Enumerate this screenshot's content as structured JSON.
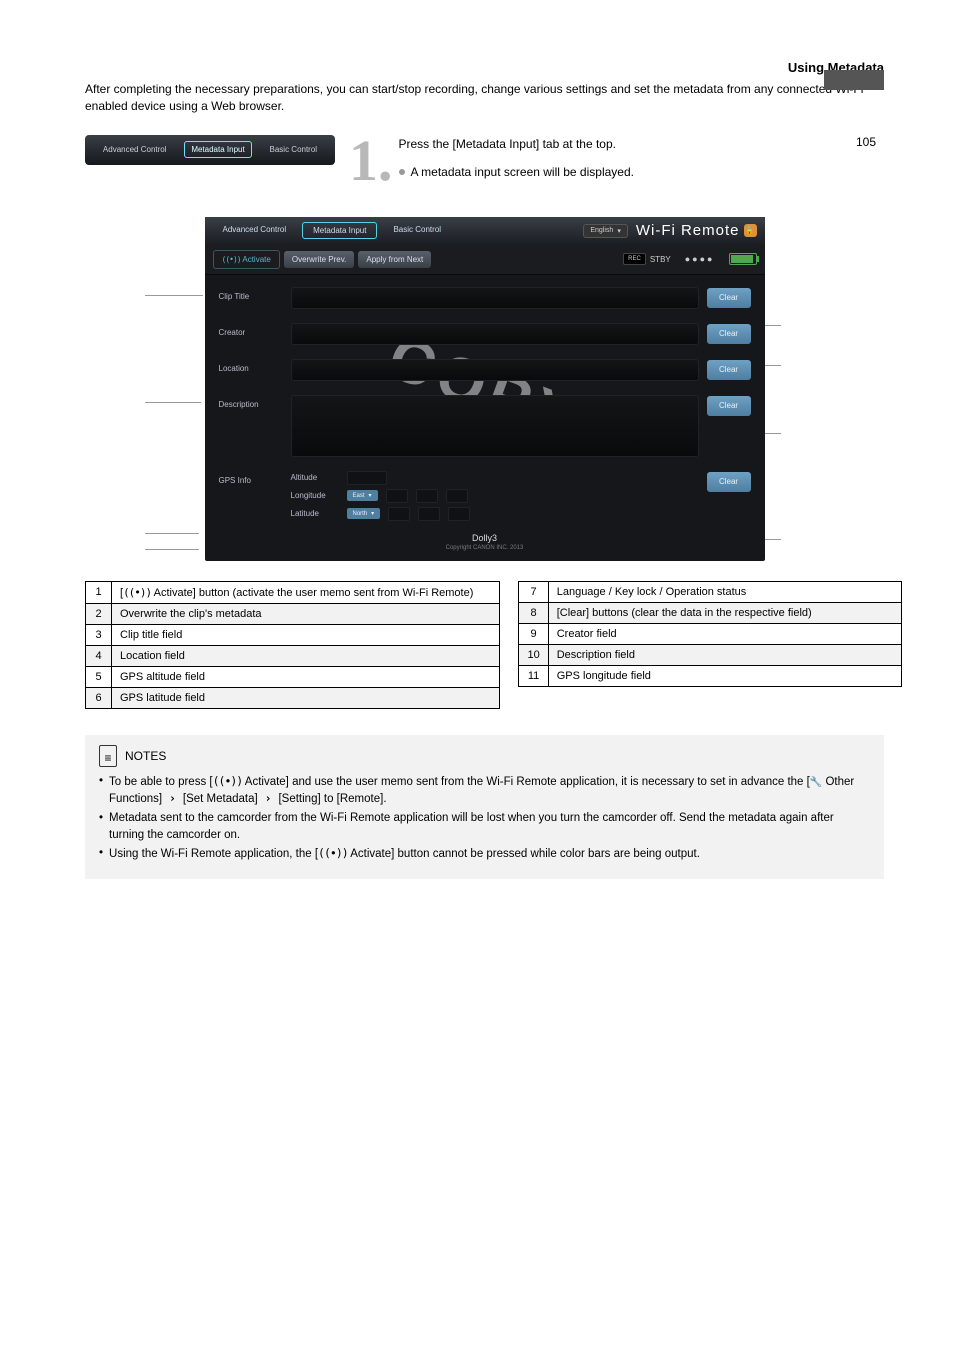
{
  "page": {
    "header": "Using Metadata",
    "number": "105"
  },
  "intro": "After completing the necessary preparations, you can start/stop recording, change various settings and set the metadata from any connected Wi-Fi enabled device using a Web browser.",
  "step1": {
    "main": "Press the [Metadata Input] tab at the top.",
    "sub": "A metadata input screen will be displayed."
  },
  "tabsImg": {
    "t1": "Advanced Control",
    "t2": "Metadata Input",
    "t3": "Basic Control"
  },
  "screenshot": {
    "tabs": {
      "t1": "Advanced Control",
      "t2": "Metadata Input",
      "t3": "Basic Control"
    },
    "lang": "English",
    "brand": "Wi-Fi Remote",
    "activate": "Activate",
    "overwrite": "Overwrite Prev.",
    "applyNext": "Apply from Next",
    "stby": "STBY",
    "fields": {
      "clipTitle": "Clip Title",
      "creator": "Creator",
      "location": "Location",
      "description": "Description",
      "gps": "GPS Info",
      "altitude": "Altitude",
      "longitude": "Longitude",
      "latitude": "Latitude",
      "east": "East",
      "north": "North"
    },
    "clear": "Clear",
    "footer": "Dolly3",
    "copyright": "Copyright CANON INC. 2013"
  },
  "tableLeft": [
    {
      "i": "1",
      "d": "[Activate] button (activate the user memo sent from Wi-Fi Remote)"
    },
    {
      "i": "2",
      "d": "Overwrite the clip's metadata"
    },
    {
      "i": "3",
      "d": "Clip title field"
    },
    {
      "i": "4",
      "d": "Location field"
    },
    {
      "i": "5",
      "d": "GPS altitude field"
    },
    {
      "i": "6",
      "d": "GPS latitude field"
    }
  ],
  "tableRight": [
    {
      "i": "7",
      "d": "Language / Key lock / Operation status"
    },
    {
      "i": "8",
      "d": "[Clear] buttons (clear the data in the respective field)"
    },
    {
      "i": "9",
      "d": "Creator field"
    },
    {
      "i": "10",
      "d": "Description field"
    },
    {
      "i": "11",
      "d": "GPS longitude field"
    }
  ],
  "notes": {
    "title": "NOTES",
    "items": [
      "To be able to press [Activate] and use the user memo sent from the Wi-Fi Remote application, it is necessary to set in advance the [Other Functions] [Set Metadata] [Setting] to [Remote].",
      "Metadata sent to the camcorder from the Wi-Fi Remote application will be lost when you turn the camcorder off. Send the metadata again after turning the camcorder on.",
      "Using the Wi-Fi Remote application, the [Activate] button cannot be pressed while color bars are being output."
    ],
    "antenna_insert": "((•)) ",
    "submenu1": " Other Functions",
    "submenu2": "Set Metadata",
    "submenu3": "Setting"
  }
}
